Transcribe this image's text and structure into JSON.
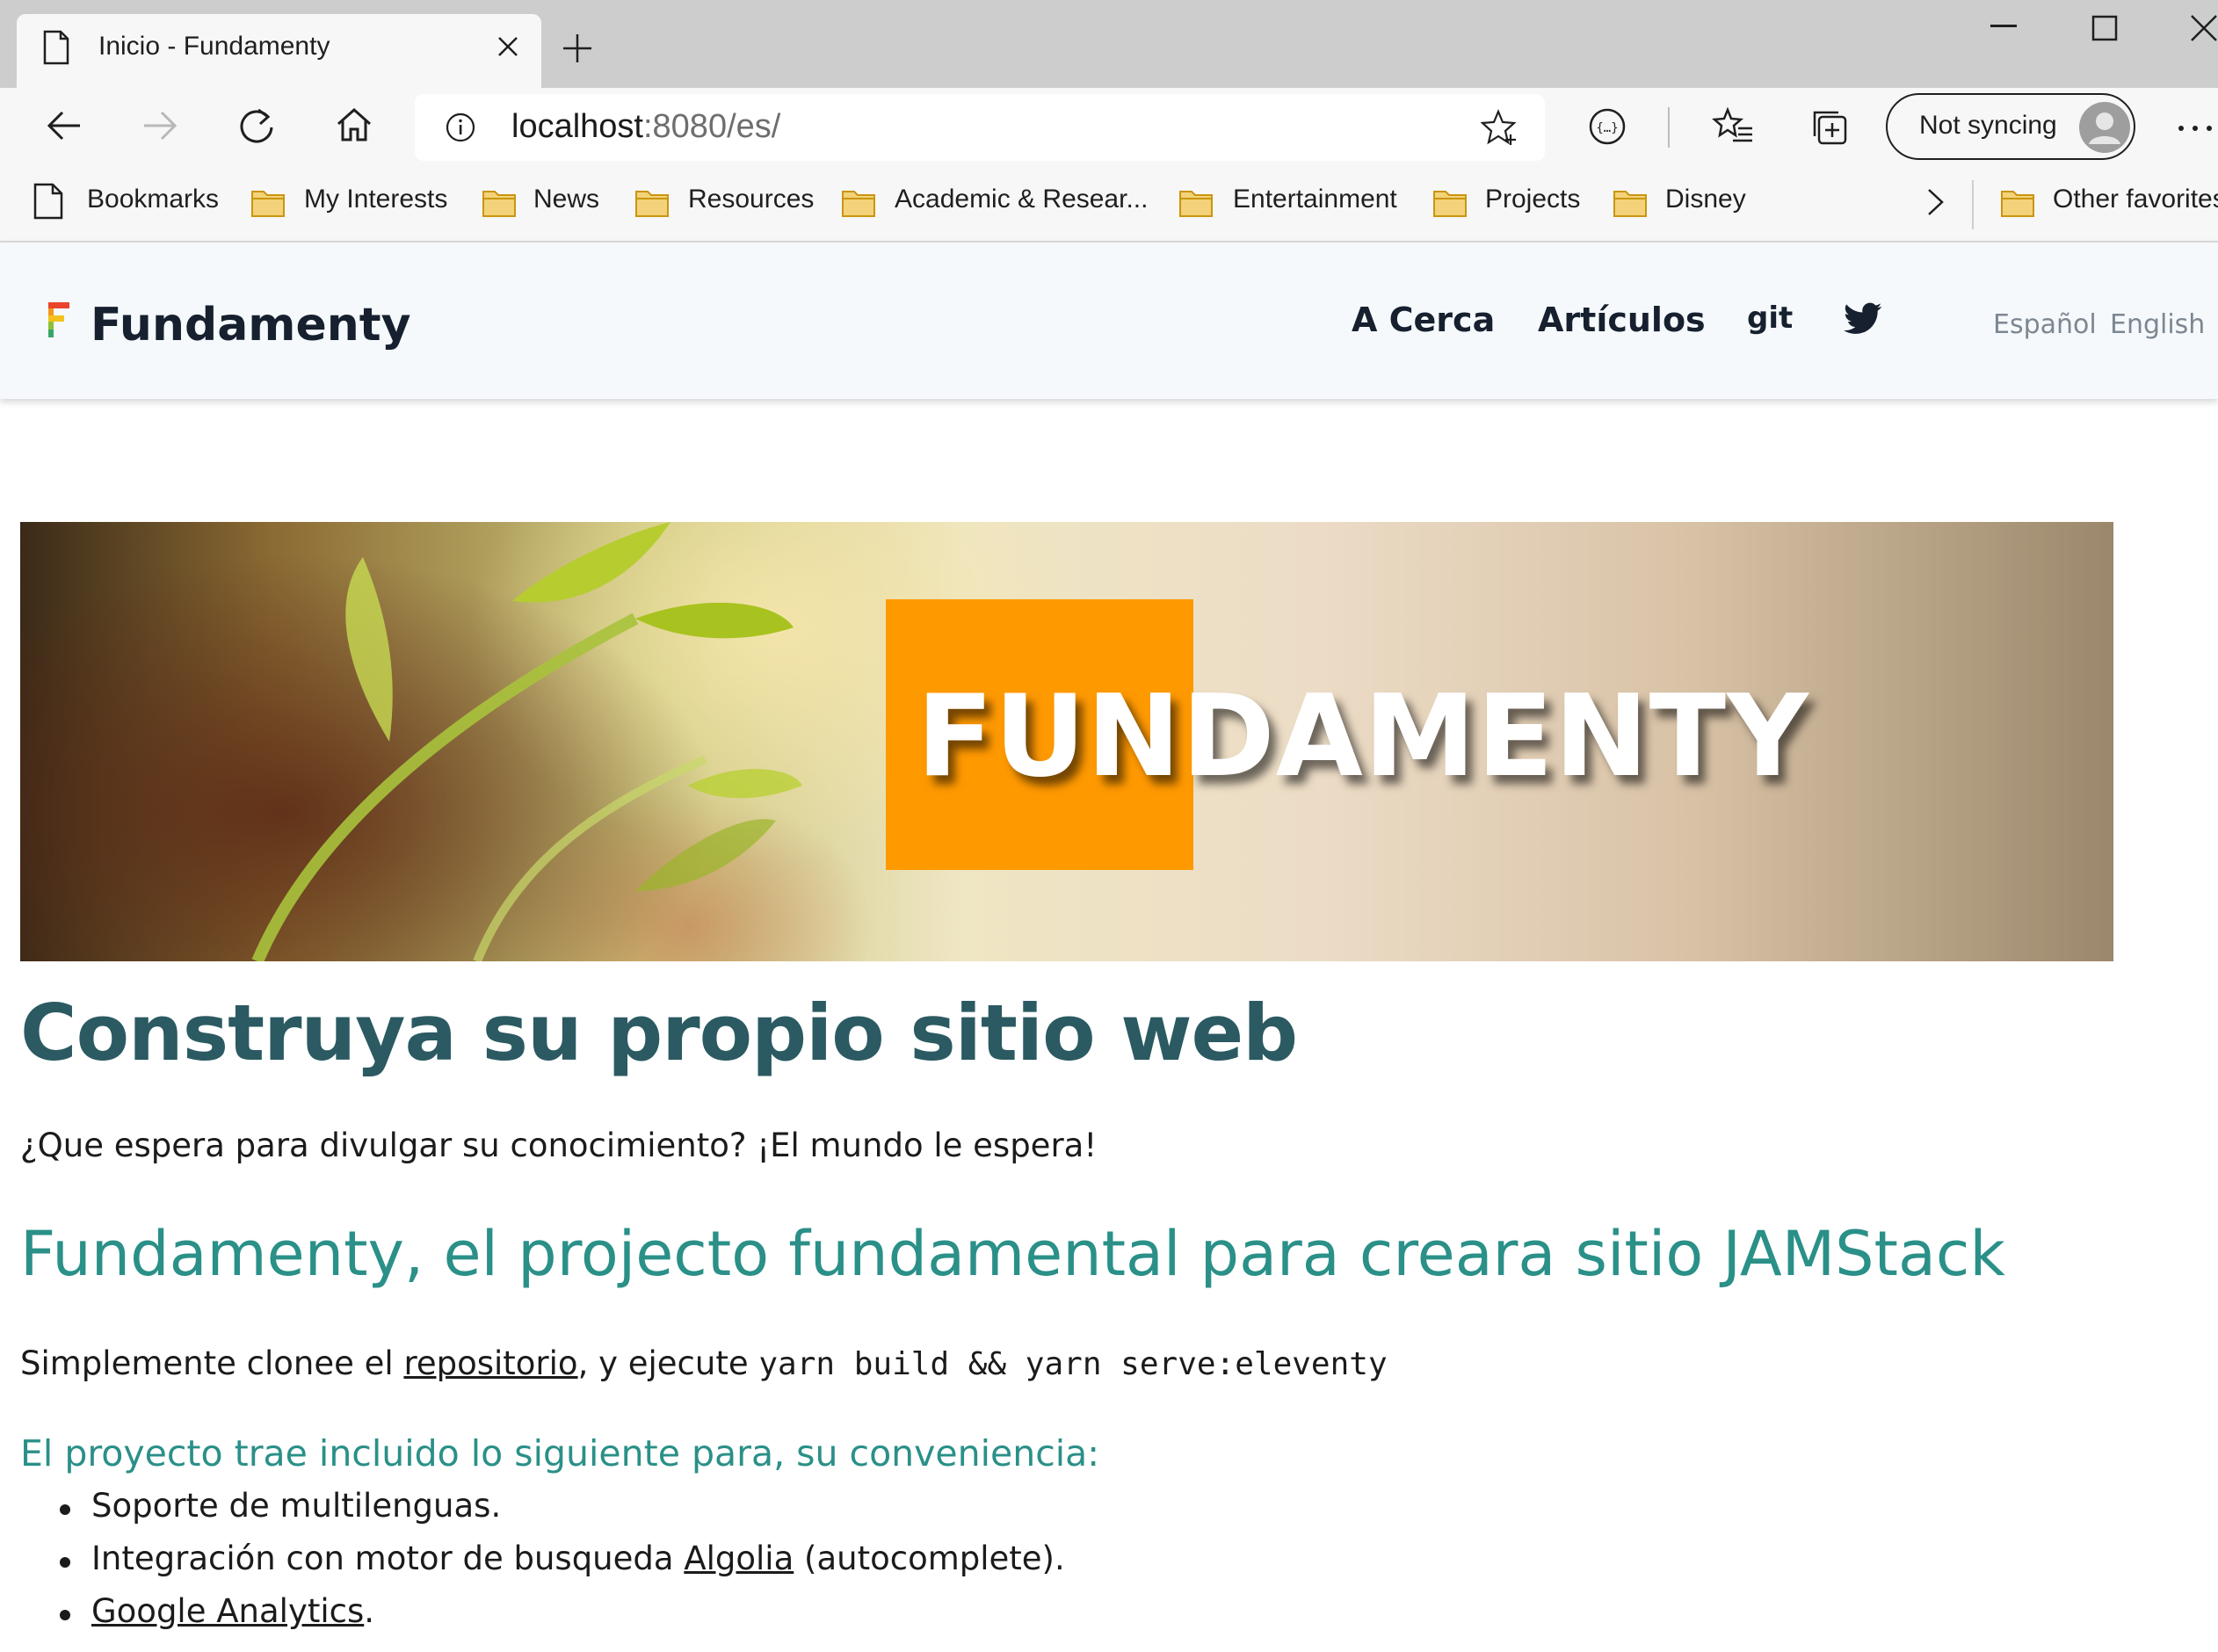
{
  "browser": {
    "tab_title": "Inicio - Fundamenty",
    "address_host": "localhost",
    "address_rest": ":8080/es/",
    "sync_label": "Not syncing",
    "bookmarks": [
      {
        "label": "Bookmarks",
        "icon": "page-icon"
      },
      {
        "label": "My Interests",
        "icon": "folder-icon"
      },
      {
        "label": "News",
        "icon": "folder-icon"
      },
      {
        "label": "Resources",
        "icon": "folder-icon"
      },
      {
        "label": "Academic & Resear...",
        "icon": "folder-icon"
      },
      {
        "label": "Entertainment",
        "icon": "folder-icon"
      },
      {
        "label": "Projects",
        "icon": "folder-icon"
      },
      {
        "label": "Disney",
        "icon": "folder-icon"
      }
    ],
    "other_favorites": "Other favorites",
    "colors": {
      "tabbar": "#cdcdcd",
      "toolbar": "#f7f7f7",
      "folder": "#e8b923"
    }
  },
  "site": {
    "brand": "Fundamenty",
    "nav": [
      "A Cerca",
      "Artículos",
      "git"
    ],
    "languages": [
      "Español",
      "English"
    ],
    "hero_word": "FUNDAMENTY",
    "title": "Construya su propio sitio web",
    "intro": "¿Que espera para divulgar su conocimiento? ¡El mundo le espera!",
    "subtitle": "Fundamenty, el projecto fundamental para creara sitio JAMStack",
    "clone_pre": "Simplemente clonee el ",
    "clone_link": "repositorio",
    "clone_mid": ", y ejecute ",
    "clone_code": "yarn build && yarn serve:eleventy",
    "features_heading": "El proyecto trae incluido lo siguiente para, su conveniencia:",
    "features": [
      {
        "pre": "Soporte de multilenguas.",
        "link": "",
        "post": ""
      },
      {
        "pre": "Integración con motor de busqueda ",
        "link": "Algolia",
        "post": " (autocomplete)."
      },
      {
        "pre": "",
        "link": "Google Analytics",
        "post": "."
      }
    ],
    "colors": {
      "heading": "#2b5a62",
      "accent": "#2a9088",
      "hero_orange": "#ff9900",
      "header_bg": "#f6f9fc"
    }
  }
}
